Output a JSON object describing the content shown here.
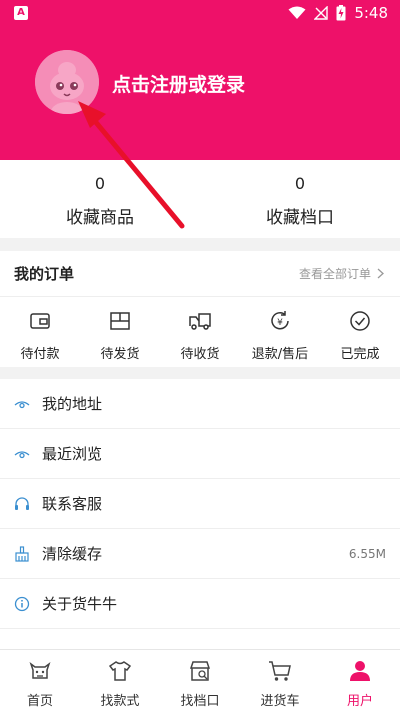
{
  "status_bar": {
    "time": "5:48",
    "left_badge": "A"
  },
  "header": {
    "login_text": "点击注册或登录"
  },
  "favorites": [
    {
      "count": "0",
      "label": "收藏商品"
    },
    {
      "count": "0",
      "label": "收藏档口"
    }
  ],
  "orders": {
    "title": "我的订单",
    "view_all": "查看全部订单",
    "items": [
      {
        "label": "待付款",
        "icon": "wallet-icon"
      },
      {
        "label": "待发货",
        "icon": "package-icon"
      },
      {
        "label": "待收货",
        "icon": "truck-icon"
      },
      {
        "label": "退款/售后",
        "icon": "refund-icon"
      },
      {
        "label": "已完成",
        "icon": "check-circle-icon"
      }
    ]
  },
  "menu": [
    {
      "label": "我的地址",
      "icon": "eye-icon"
    },
    {
      "label": "最近浏览",
      "icon": "eye-icon"
    },
    {
      "label": "联系客服",
      "icon": "headset-icon"
    },
    {
      "label": "清除缓存",
      "icon": "broom-icon",
      "value": "6.55M"
    },
    {
      "label": "关于货牛牛",
      "icon": "info-icon"
    }
  ],
  "tabs": [
    {
      "label": "首页",
      "icon": "cow-icon"
    },
    {
      "label": "找款式",
      "icon": "tshirt-icon"
    },
    {
      "label": "找档口",
      "icon": "store-icon"
    },
    {
      "label": "进货车",
      "icon": "cart-icon"
    },
    {
      "label": "用户",
      "icon": "user-icon",
      "active": true
    }
  ],
  "colors": {
    "brand": "#ee1169",
    "menu_icon": "#3b8fd0"
  }
}
